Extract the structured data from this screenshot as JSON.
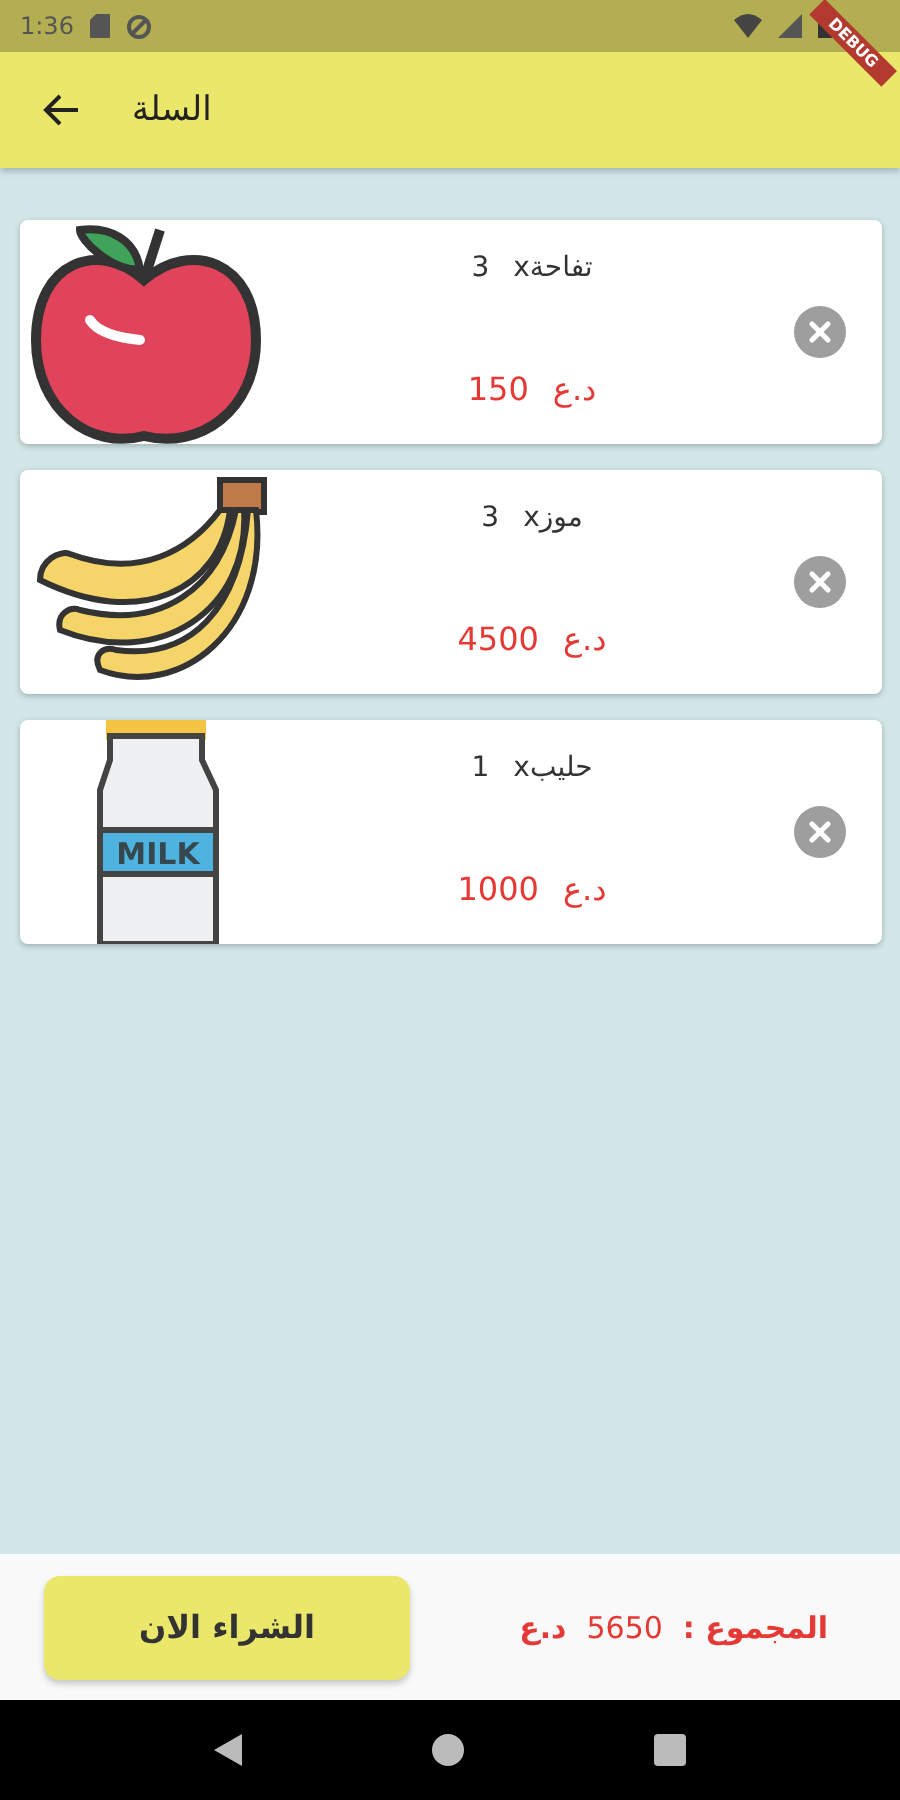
{
  "status_bar": {
    "time": "1:36"
  },
  "debug_banner": {
    "text": "DEBUG"
  },
  "app_bar": {
    "title": "السلة"
  },
  "cart_items": [
    {
      "kind": "apple",
      "name": "xتفاحة",
      "quantity": "3",
      "price": "150",
      "currency": "د.ع"
    },
    {
      "kind": "banana",
      "name": "xموز",
      "quantity": "3",
      "price": "4500",
      "currency": "د.ع"
    },
    {
      "kind": "milk",
      "image_label": "MILK",
      "name": "xحليب",
      "quantity": "1",
      "price": "1000",
      "currency": "د.ع"
    }
  ],
  "footer": {
    "total_label": "المجموع :",
    "total_value": "5650",
    "currency": "د.ع",
    "buy_button": "الشراء الان"
  }
}
